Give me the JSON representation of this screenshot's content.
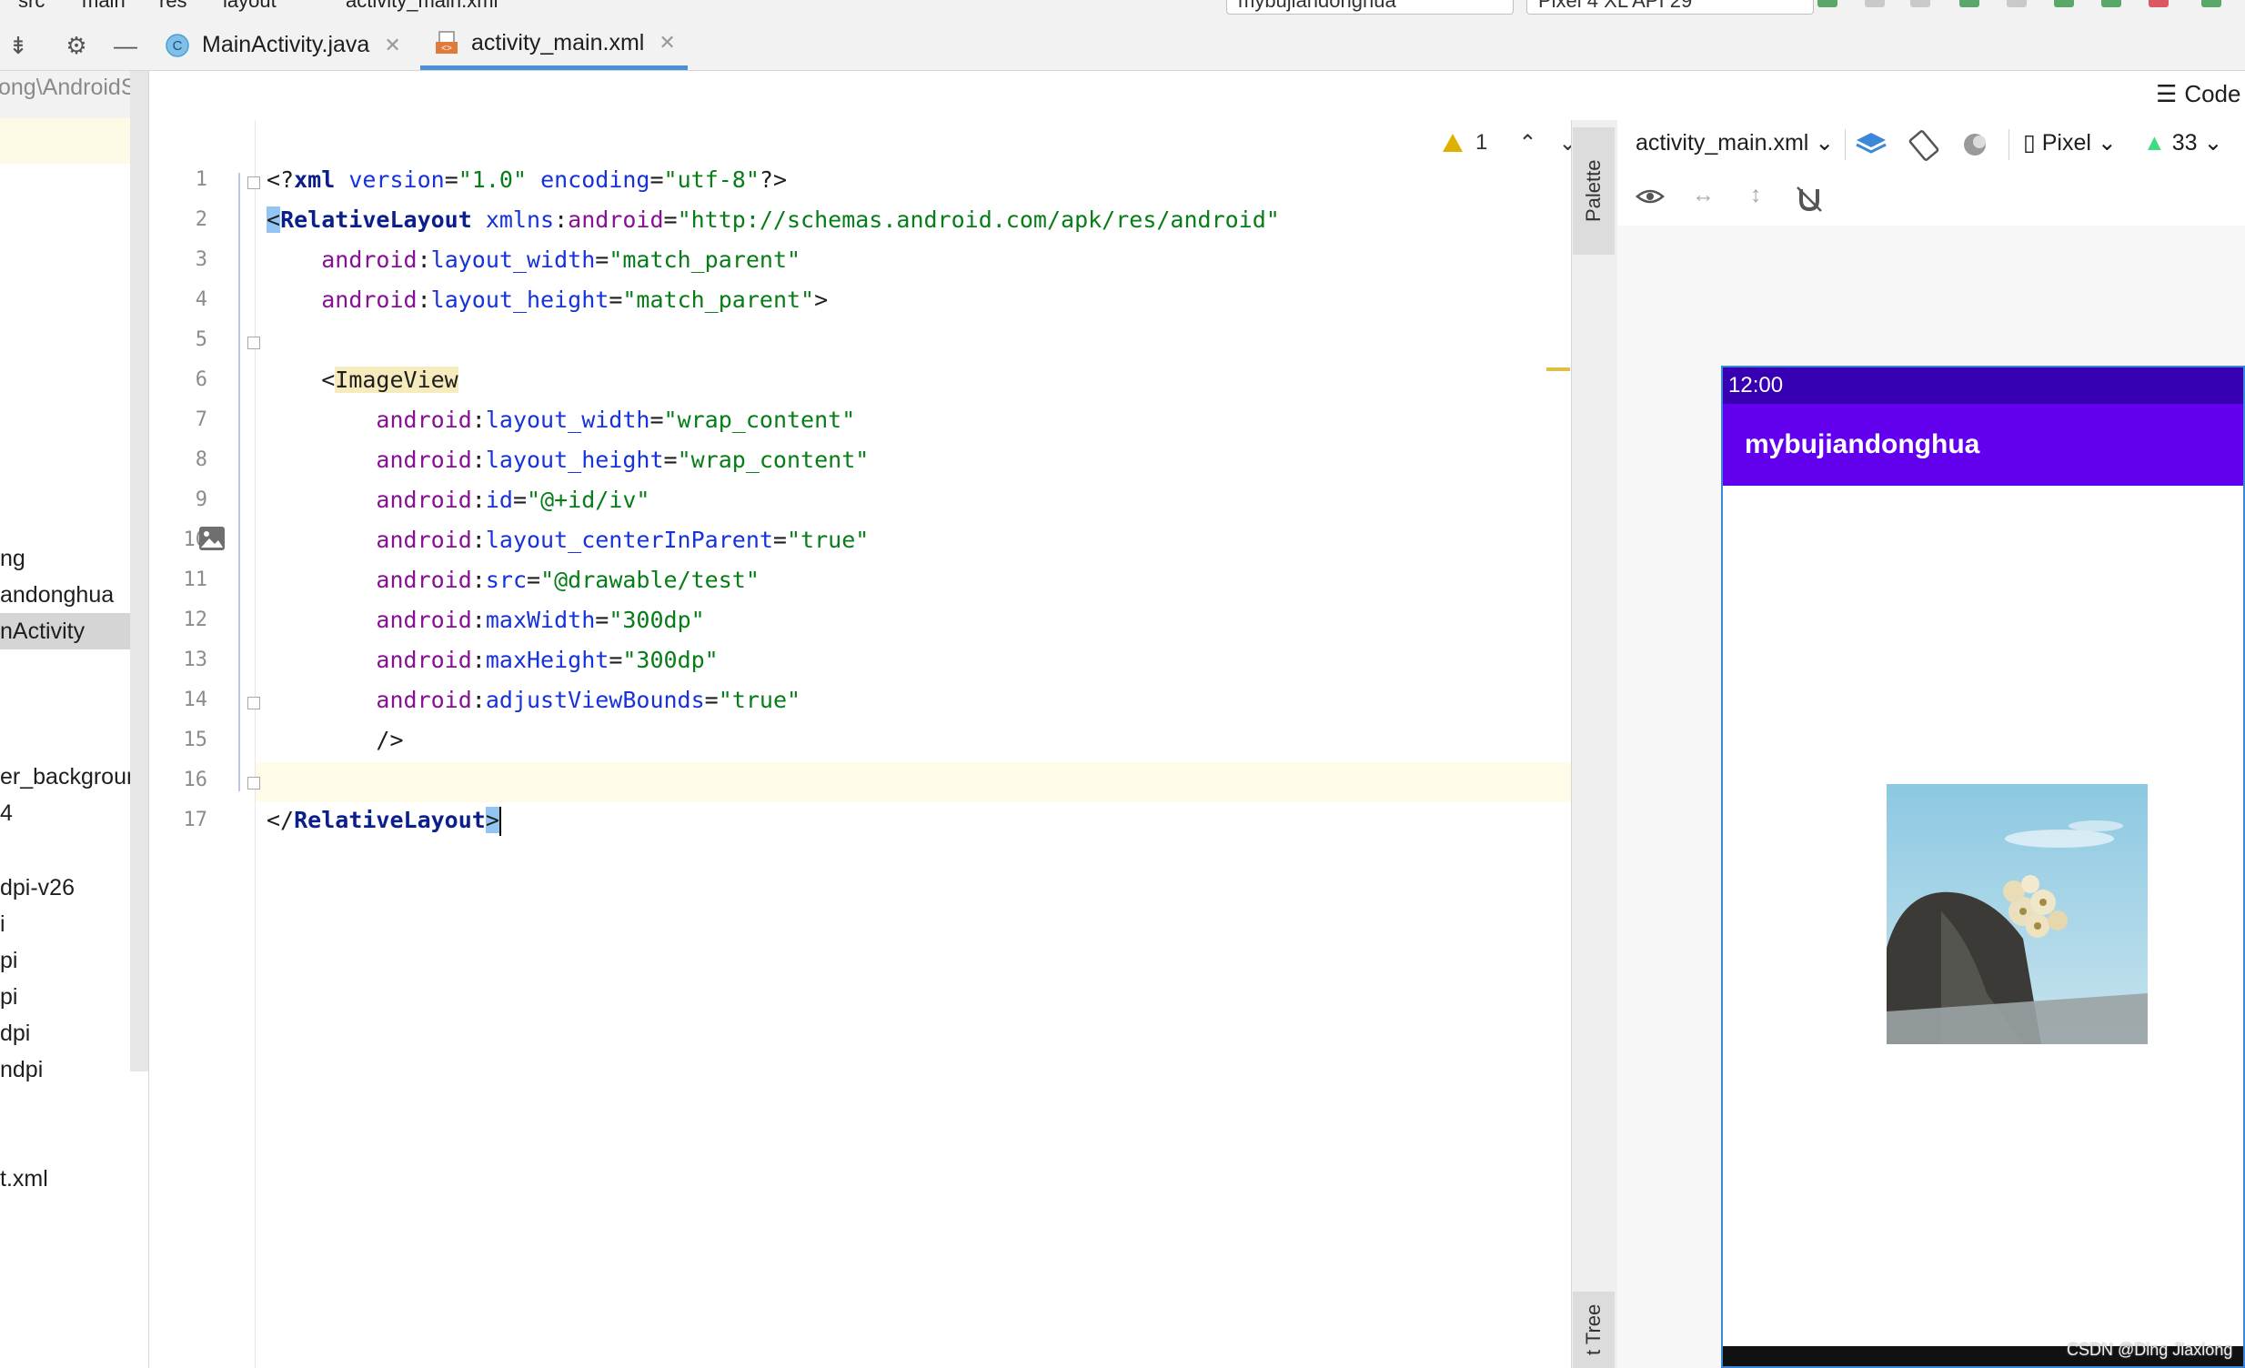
{
  "topbar": {
    "breadcrumb": [
      "src",
      "main",
      "res",
      "layout",
      "activity_main.xml"
    ],
    "run_config": "mybujiandonghua",
    "device": "Pixel 4 XL API 29"
  },
  "tabs": [
    {
      "label": "MainActivity.java",
      "icon": "java-class-icon",
      "active": false
    },
    {
      "label": "activity_main.xml",
      "icon": "xml-layout-icon",
      "active": true
    }
  ],
  "project_panel": {
    "path": "ong\\AndroidStu",
    "items": [
      {
        "label": "ng"
      },
      {
        "label": "andonghua"
      },
      {
        "label": "nActivity",
        "selected": true
      },
      {
        "label": "er_background"
      },
      {
        "label": "4"
      },
      {
        "label": "dpi-v26"
      },
      {
        "label": "i"
      },
      {
        "label": "pi"
      },
      {
        "label": "pi"
      },
      {
        "label": "dpi"
      },
      {
        "label": "ndpi"
      },
      {
        "label": "t.xml"
      }
    ]
  },
  "editor": {
    "line_numbers": [
      "1",
      "2",
      "3",
      "4",
      "5",
      "6",
      "7",
      "8",
      "9",
      "10",
      "11",
      "12",
      "13",
      "14",
      "15",
      "16",
      "17"
    ],
    "warnings_count": "1",
    "lines": [
      [
        {
          "c": "p",
          "t": "<?"
        },
        {
          "c": "t",
          "t": "xml"
        },
        {
          "c": "a",
          "t": " version"
        },
        {
          "c": "p",
          "t": "="
        },
        {
          "c": "v",
          "t": "\"1.0\""
        },
        {
          "c": "a",
          "t": " encoding"
        },
        {
          "c": "p",
          "t": "="
        },
        {
          "c": "v",
          "t": "\"utf-8\""
        },
        {
          "c": "p",
          "t": "?>"
        }
      ],
      [
        {
          "c": "brk",
          "t": "<"
        },
        {
          "c": "t",
          "t": "RelativeLayout"
        },
        {
          "c": "a",
          "t": " xmlns"
        },
        {
          "c": "p",
          "t": ":"
        },
        {
          "c": "ns",
          "t": "android"
        },
        {
          "c": "p",
          "t": "="
        },
        {
          "c": "v",
          "t": "\"http://schemas.android.com/apk/res/android\""
        }
      ],
      [
        {
          "c": "p",
          "t": "    "
        },
        {
          "c": "ns",
          "t": "android"
        },
        {
          "c": "p",
          "t": ":"
        },
        {
          "c": "a",
          "t": "layout_width"
        },
        {
          "c": "p",
          "t": "="
        },
        {
          "c": "v",
          "t": "\"match_parent\""
        }
      ],
      [
        {
          "c": "p",
          "t": "    "
        },
        {
          "c": "ns",
          "t": "android"
        },
        {
          "c": "p",
          "t": ":"
        },
        {
          "c": "a",
          "t": "layout_height"
        },
        {
          "c": "p",
          "t": "="
        },
        {
          "c": "v",
          "t": "\"match_parent\""
        },
        {
          "c": "p",
          "t": ">"
        }
      ],
      [],
      [
        {
          "c": "p",
          "t": "    <"
        },
        {
          "c": "hlt",
          "t": "ImageView"
        }
      ],
      [
        {
          "c": "p",
          "t": "        "
        },
        {
          "c": "ns",
          "t": "android"
        },
        {
          "c": "p",
          "t": ":"
        },
        {
          "c": "a",
          "t": "layout_width"
        },
        {
          "c": "p",
          "t": "="
        },
        {
          "c": "v",
          "t": "\"wrap_content\""
        }
      ],
      [
        {
          "c": "p",
          "t": "        "
        },
        {
          "c": "ns",
          "t": "android"
        },
        {
          "c": "p",
          "t": ":"
        },
        {
          "c": "a",
          "t": "layout_height"
        },
        {
          "c": "p",
          "t": "="
        },
        {
          "c": "v",
          "t": "\"wrap_content\""
        }
      ],
      [
        {
          "c": "p",
          "t": "        "
        },
        {
          "c": "ns",
          "t": "android"
        },
        {
          "c": "p",
          "t": ":"
        },
        {
          "c": "a",
          "t": "id"
        },
        {
          "c": "p",
          "t": "="
        },
        {
          "c": "v",
          "t": "\"@+id/iv\""
        }
      ],
      [
        {
          "c": "p",
          "t": "        "
        },
        {
          "c": "ns",
          "t": "android"
        },
        {
          "c": "p",
          "t": ":"
        },
        {
          "c": "a",
          "t": "layout_centerInParent"
        },
        {
          "c": "p",
          "t": "="
        },
        {
          "c": "v",
          "t": "\"true\""
        }
      ],
      [
        {
          "c": "p",
          "t": "        "
        },
        {
          "c": "ns",
          "t": "android"
        },
        {
          "c": "p",
          "t": ":"
        },
        {
          "c": "a",
          "t": "src"
        },
        {
          "c": "p",
          "t": "="
        },
        {
          "c": "v",
          "t": "\"@drawable/test\""
        }
      ],
      [
        {
          "c": "p",
          "t": "        "
        },
        {
          "c": "ns",
          "t": "android"
        },
        {
          "c": "p",
          "t": ":"
        },
        {
          "c": "a",
          "t": "maxWidth"
        },
        {
          "c": "p",
          "t": "="
        },
        {
          "c": "v",
          "t": "\"300dp\""
        }
      ],
      [
        {
          "c": "p",
          "t": "        "
        },
        {
          "c": "ns",
          "t": "android"
        },
        {
          "c": "p",
          "t": ":"
        },
        {
          "c": "a",
          "t": "maxHeight"
        },
        {
          "c": "p",
          "t": "="
        },
        {
          "c": "v",
          "t": "\"300dp\""
        }
      ],
      [
        {
          "c": "p",
          "t": "        "
        },
        {
          "c": "ns",
          "t": "android"
        },
        {
          "c": "p",
          "t": ":"
        },
        {
          "c": "a",
          "t": "adjustViewBounds"
        },
        {
          "c": "p",
          "t": "="
        },
        {
          "c": "v",
          "t": "\"true\""
        }
      ],
      [
        {
          "c": "p",
          "t": "        />"
        }
      ],
      [],
      [
        {
          "c": "p",
          "t": "</"
        },
        {
          "c": "t",
          "t": "RelativeLayout"
        },
        {
          "c": "brk",
          "t": ">"
        }
      ]
    ]
  },
  "side_tabs": {
    "palette": "Palette",
    "component_tree": "t Tree"
  },
  "design": {
    "mode_label": "Code",
    "file_label": "activity_main.xml",
    "device_label": "Pixel",
    "api_label": "33",
    "preview": {
      "status_time": "12:00",
      "app_title": "mybujiandonghua"
    }
  },
  "colors": {
    "status_bar": "#3700b3",
    "app_bar": "#6200ee",
    "selection_border": "#3d87d8"
  },
  "watermark": "CSDN @Ding Jiaxiong"
}
